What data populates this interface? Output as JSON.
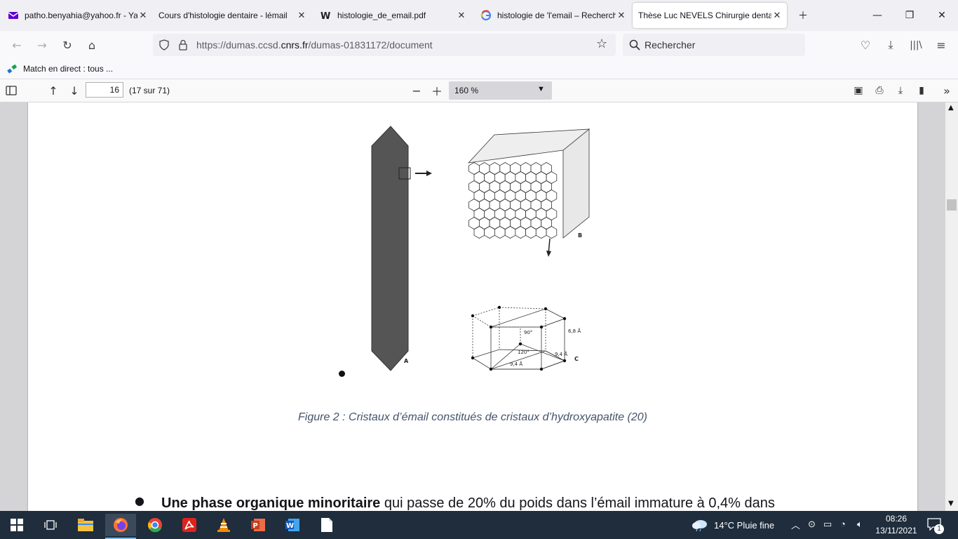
{
  "browser": {
    "tabs": [
      {
        "title": "patho.benyahia@yahoo.fr - Yah",
        "icon": "mail-icon"
      },
      {
        "title": "Cours d'histologie dentaire - lémail",
        "icon": "page-icon"
      },
      {
        "title": "histologie_de_email.pdf",
        "icon": "w-icon"
      },
      {
        "title": "histologie de 'l'email – Recherch",
        "icon": "google-icon"
      },
      {
        "title": "Thèse Luc NEVELS Chirurgie dentair",
        "icon": "none"
      }
    ],
    "url_prefix": "https://dumas.ccsd.",
    "url_domain": "cnrs.fr",
    "url_suffix": "/dumas-01831172/document",
    "search_placeholder": "Rechercher",
    "bookmark": "Match en direct : tous ..."
  },
  "pdf_toolbar": {
    "page_number": "16",
    "page_count": "(17 sur 71)",
    "zoom": "160 %"
  },
  "document": {
    "figure_labels": {
      "a": "A",
      "b": "B",
      "c": "C",
      "angle_90": "90°",
      "angle_120": "120°",
      "dim_68": "6,8 Å",
      "dim_94_side": "9,4 Å",
      "dim_94_bottom": "9,4 Å"
    },
    "caption": "Figure 2 : Cristaux d’émail constitués de cristaux d’hydroxyapatite (20)",
    "bullet_bold": "Une phase organique minoritaire",
    "bullet_text": " qui passe de 20% du poids dans l’émail immature à 0,4% dans"
  },
  "taskbar": {
    "weather": "14°C  Pluie fine",
    "time": "08:26",
    "date": "13/11/2021",
    "notification_count": "1"
  },
  "colors": {
    "accent_tab": "#ffffff",
    "caption": "#44546a",
    "taskbar": "#1f2d3d"
  }
}
